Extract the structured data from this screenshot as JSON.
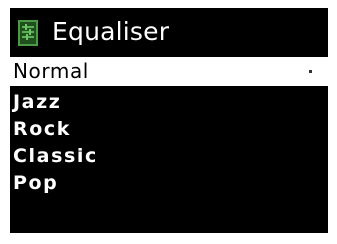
{
  "header": {
    "title": "Equaliser",
    "icon": "equaliser-icon",
    "icon_color": "#3d8a3a"
  },
  "menu": {
    "items": [
      {
        "label": "Normal",
        "selected": true
      },
      {
        "label": "Jazz",
        "selected": false
      },
      {
        "label": "Rock",
        "selected": false
      },
      {
        "label": "Classic",
        "selected": false
      },
      {
        "label": "Pop",
        "selected": false
      }
    ]
  },
  "colors": {
    "screen_background": "#000000",
    "text": "#ffffff",
    "highlight_background": "#ffffff",
    "highlight_text": "#000000"
  }
}
